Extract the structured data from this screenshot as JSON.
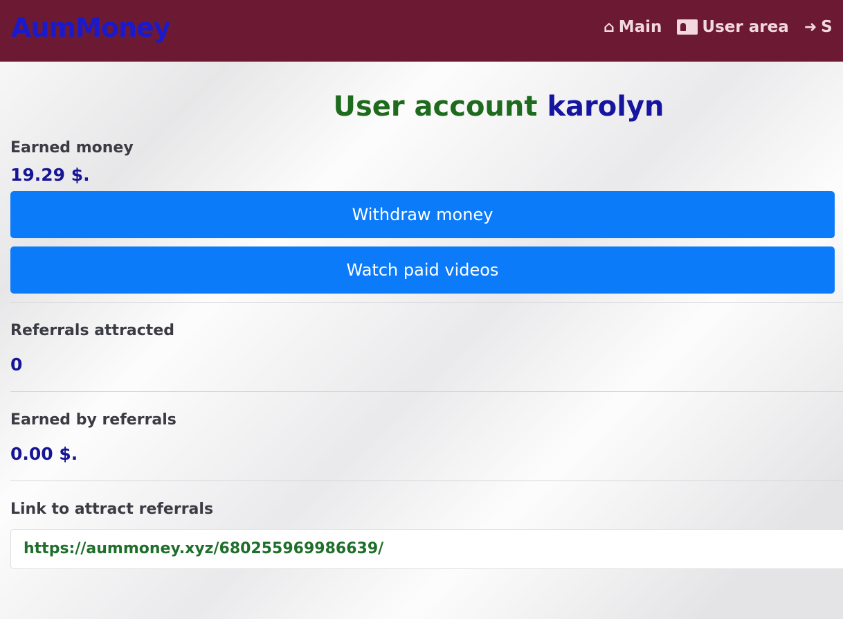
{
  "nav": {
    "brand": "AumMoney",
    "links": [
      {
        "label": "Main",
        "icon": "home-icon"
      },
      {
        "label": "User area",
        "icon": "id-card-icon"
      },
      {
        "label": "S",
        "icon": "sign-in-icon"
      }
    ]
  },
  "title": {
    "prefix": "User account",
    "username": "karolyn"
  },
  "earned": {
    "label": "Earned money",
    "value": "19.29 $."
  },
  "buttons": {
    "withdraw": "Withdraw money",
    "watch": "Watch paid videos"
  },
  "referrals": {
    "label": "Referrals attracted",
    "value": "0"
  },
  "ref_earned": {
    "label": "Earned by referrals",
    "value": "0.00 $."
  },
  "ref_link": {
    "label": "Link to attract referrals",
    "value": "https://aummoney.xyz/680255969986639/"
  },
  "colors": {
    "navbar": "#6c1a33",
    "button": "#0b7bfa",
    "title_green": "#1e6b1e",
    "value_blue": "#151596"
  }
}
